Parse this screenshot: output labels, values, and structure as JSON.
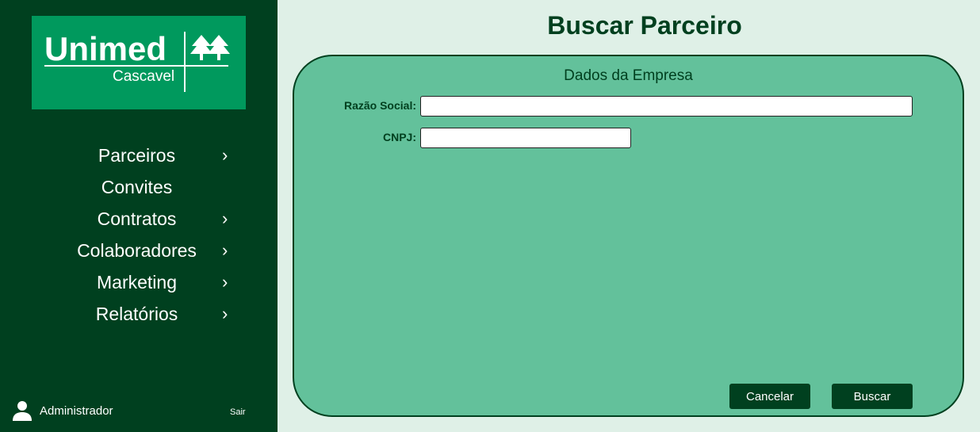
{
  "brand": {
    "name": "Unimed",
    "city": "Cascavel"
  },
  "nav": {
    "items": [
      {
        "label": "Parceiros",
        "has_submenu": true
      },
      {
        "label": "Convites",
        "has_submenu": false
      },
      {
        "label": "Contratos",
        "has_submenu": true
      },
      {
        "label": "Colaboradores",
        "has_submenu": true
      },
      {
        "label": "Marketing",
        "has_submenu": true
      },
      {
        "label": "Relatórios",
        "has_submenu": true
      }
    ],
    "chevron": "›"
  },
  "user": {
    "name": "Administrador",
    "logout_label": "Sair",
    "icon": "user-icon"
  },
  "page": {
    "title": "Buscar Parceiro"
  },
  "form": {
    "section_title": "Dados da Empresa",
    "razao_social_label": "Razão Social:",
    "razao_social_value": "",
    "cnpj_label": "CNPJ:",
    "cnpj_value": "",
    "cancel_label": "Cancelar",
    "search_label": "Buscar"
  },
  "colors": {
    "sidebar_bg": "#00401f",
    "brand_green": "#00995d",
    "card_bg": "#63c19b",
    "page_bg": "#dff0e7",
    "button_bg": "#00401f"
  }
}
